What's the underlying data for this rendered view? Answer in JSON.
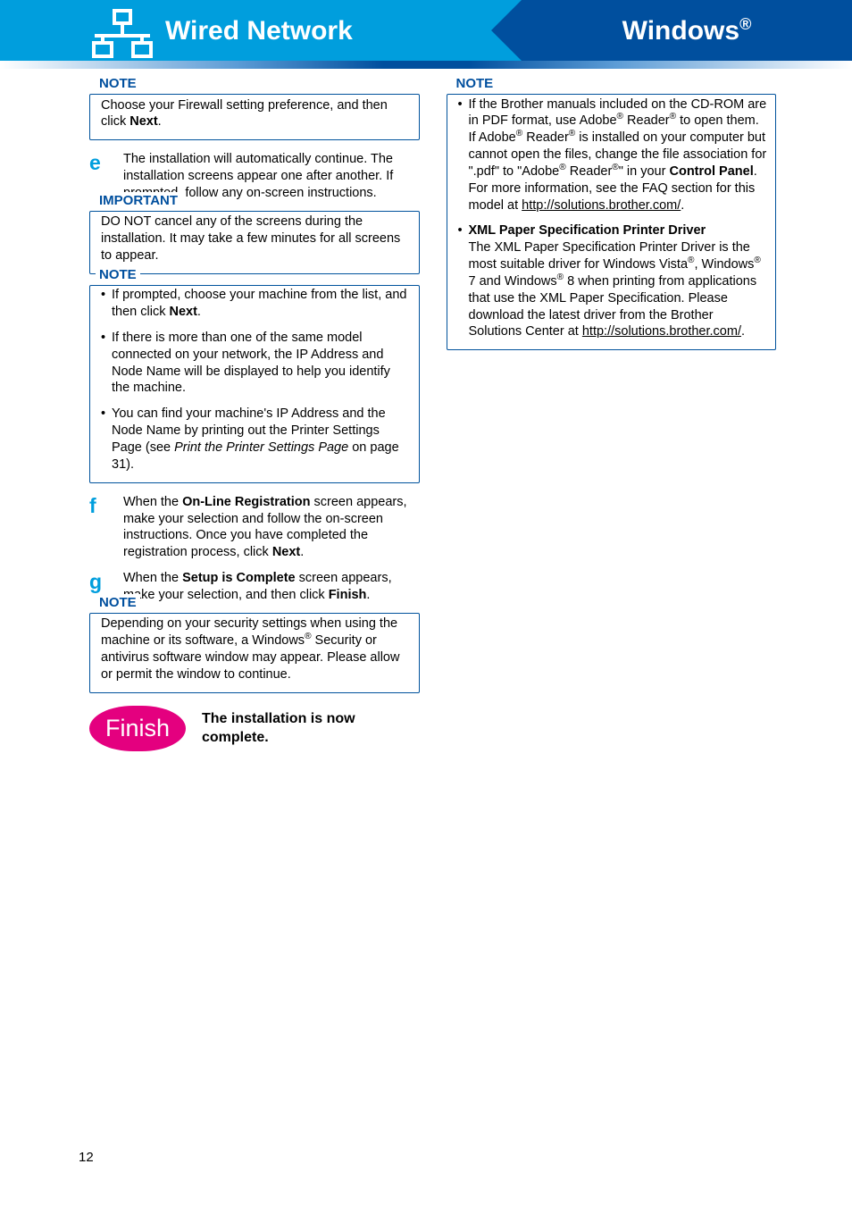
{
  "header": {
    "left_title": "Wired Network",
    "right_title": "Windows",
    "right_super": "®"
  },
  "left_column": {
    "note1": {
      "title": "NOTE",
      "body_pre": "Choose your Firewall setting preference, and then click ",
      "body_bold": "Next",
      "body_post": "."
    },
    "step_e": {
      "letter": "e",
      "text": "The installation will automatically continue. The installation screens appear one after another. If prompted, follow any on-screen instructions."
    },
    "important": {
      "title": "IMPORTANT",
      "body": "DO NOT cancel any of the screens during the installation. It may take a few minutes for all screens to appear."
    },
    "note2": {
      "title": "NOTE",
      "items": [
        {
          "pre": "If prompted, choose your machine from the list, and then click ",
          "bold": "Next",
          "post": "."
        },
        {
          "full": "If there is more than one of the same model connected on your network, the IP Address and Node Name will be displayed to help you identify the machine."
        },
        {
          "pre": "You can find your machine's IP Address and the Node Name by printing out the Printer Settings Page (see ",
          "italic": "Print the Printer Settings Page",
          "post2": " on page 31)."
        }
      ]
    },
    "step_f": {
      "letter": "f",
      "pre": "When the ",
      "bold1": "On-Line Registration",
      "mid": " screen appears, make your selection and follow the on-screen instructions. Once you have completed the registration process, click ",
      "bold2": "Next",
      "post": "."
    },
    "step_g": {
      "letter": "g",
      "pre": "When the ",
      "bold1": "Setup is Complete",
      "mid": " screen appears, make your selection, and then click ",
      "bold2": "Finish",
      "post": "."
    },
    "note3": {
      "title": "NOTE",
      "pre": "Depending on your security settings when using the machine or its software, a Windows",
      "sup": "®",
      "post": " Security or antivirus software window may appear. Please allow or permit the window to continue."
    },
    "finish": {
      "badge": "Finish",
      "text": "The installation is now complete."
    }
  },
  "right_column": {
    "note": {
      "title": "NOTE",
      "item1": {
        "t1": "If the Brother manuals included on the CD-ROM are in PDF format, use Adobe",
        "s1": "®",
        "t2": " Reader",
        "s2": "®",
        "t3": " to open them. If Adobe",
        "s3": "®",
        "t4": " Reader",
        "s4": "®",
        "t5": " is installed on your computer but cannot open the files, change the file association for \".pdf\" to \"Adobe",
        "s5": "®",
        "t6": " Reader",
        "s6": "®",
        "t7": "\" in your ",
        "b1": "Control Panel",
        "t8": ". For more information, see the FAQ section for this model at ",
        "link": "http://solutions.brother.com/",
        "t9": "."
      },
      "item2": {
        "b1": "XML Paper Specification Printer Driver",
        "t1": "The XML Paper Specification Printer Driver is the most suitable driver for Windows Vista",
        "s1": "®",
        "t2": ", Windows",
        "s2": "®",
        "t3": " 7 and Windows",
        "s3": "®",
        "t4": " 8 when printing from applications that use the XML Paper Specification. Please download the latest driver from the Brother Solutions Center at ",
        "link": "http://solutions.brother.com/",
        "t5": "."
      }
    }
  },
  "page_number": "12"
}
